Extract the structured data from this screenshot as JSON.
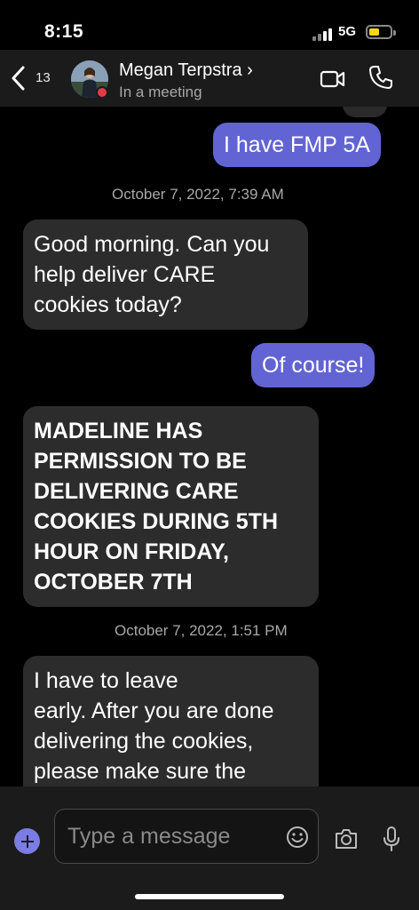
{
  "status_bar": {
    "time": "8:15",
    "network": "5G",
    "signal_icon": "signal-bars-icon",
    "battery_icon": "battery-icon",
    "battery_level": 0.35,
    "battery_color": "#f7d51d"
  },
  "header": {
    "back_count": "13",
    "contact_name": "Megan Terpstra ›",
    "contact_status": "In a meeting",
    "presence_color": "#e03c48",
    "video_icon": "video-camera-icon",
    "call_icon": "phone-icon",
    "background": "#1b1b1b"
  },
  "messages": [
    {
      "direction": "outgoing",
      "text": "I have FMP 5A"
    },
    {
      "type": "timestamp",
      "text": "October 7, 2022, 7:39 AM"
    },
    {
      "direction": "incoming",
      "text": "Good morning. Can you\nhelp deliver CARE\ncookies today?"
    },
    {
      "direction": "outgoing",
      "text": "Of course!"
    },
    {
      "direction": "incoming",
      "text": "MADELINE HAS\nPERMISSION TO BE\nDELIVERING CARE\nCOOKIES DURING 5TH\nHOUR ON FRIDAY,\nOCTOBER 7TH"
    },
    {
      "type": "timestamp",
      "text": "October 7, 2022, 1:51 PM"
    },
    {
      "direction": "incoming",
      "text": "I have to leave\nearly.  After you are done\ndelivering the cookies,\nplease make sure the"
    }
  ],
  "composer": {
    "placeholder": "Type a message",
    "plus_icon": "plus-circle-icon",
    "emoji_icon": "smiley-icon",
    "camera_icon": "camera-icon",
    "mic_icon": "microphone-icon"
  },
  "colors": {
    "outgoing_bubble": "#6264d4",
    "incoming_bubble": "#2c2c2c",
    "background": "#000000",
    "accent": "#7b7de3"
  }
}
